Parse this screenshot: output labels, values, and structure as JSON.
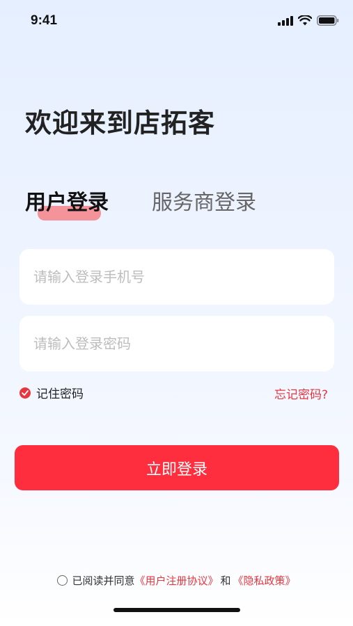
{
  "status_bar": {
    "time": "9:41"
  },
  "title": "欢迎来到店拓客",
  "tabs": {
    "user_login": "用户登录",
    "provider_login": "服务商登录"
  },
  "form": {
    "phone_placeholder": "请输入登录手机号",
    "password_placeholder": "请输入登录密码",
    "remember_label": "记住密码",
    "forgot_label": "忘记密码?",
    "login_button": "立即登录"
  },
  "agreement": {
    "prefix": "已阅读并同意",
    "user_agreement": "《用户注册协议》",
    "conjunction": "和",
    "privacy_policy": "《隐私政策》"
  },
  "colors": {
    "accent": "#ff2e3e",
    "link": "#e8363f",
    "tab_highlight": "#f5939b"
  }
}
